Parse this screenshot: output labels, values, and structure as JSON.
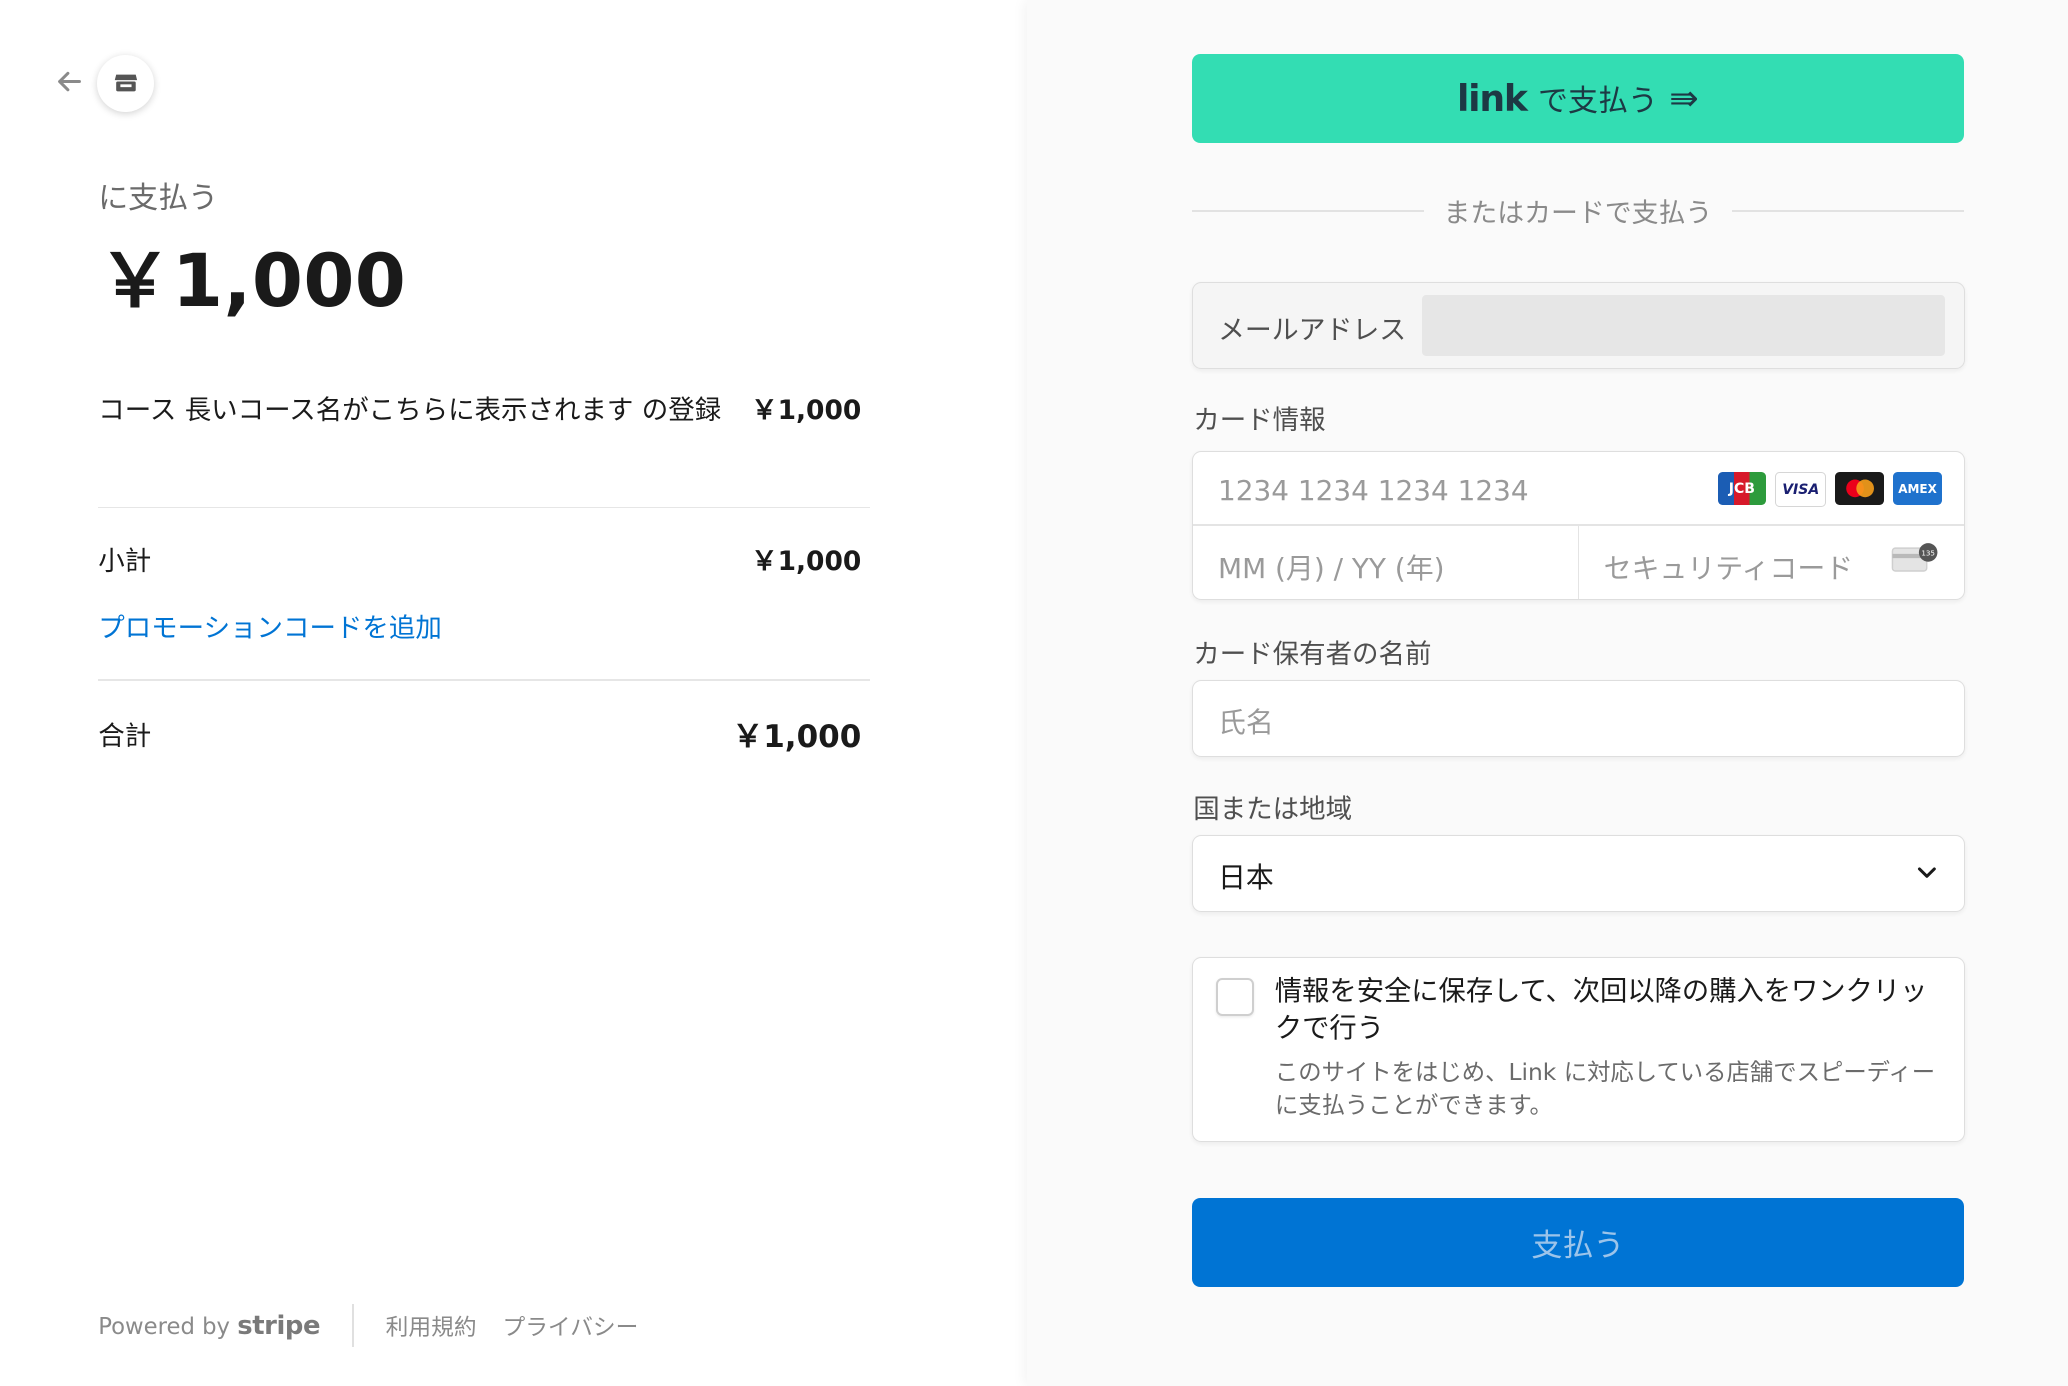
{
  "summary": {
    "pay_to": "に支払う",
    "amount": "￥1,000",
    "item_name": "コース 長いコース名がこちらに表示されます の登録",
    "item_price": "￥1,000",
    "subtotal_label": "小計",
    "subtotal_value": "￥1,000",
    "promo_link": "プロモーションコードを追加",
    "total_label": "合計",
    "total_value": "￥1,000"
  },
  "footer": {
    "powered_by": "Powered by",
    "stripe": "stripe",
    "terms": "利用規約",
    "privacy": "プライバシー"
  },
  "link_button": {
    "logo": "link",
    "label": "で支払う",
    "arrow": "⇛"
  },
  "or_divider": "またはカードで支払う",
  "email": {
    "label": "メールアドレス",
    "value": ""
  },
  "card": {
    "label": "カード情報",
    "number_placeholder": "1234 1234 1234 1234",
    "expiry_placeholder": "MM (月) / YY (年)",
    "cvc_placeholder": "セキュリティコード",
    "brands": [
      "JCB",
      "VISA",
      "Mastercard",
      "AMEX"
    ],
    "cvc_hint": "135"
  },
  "cardholder": {
    "label": "カード保有者の名前",
    "placeholder": "氏名"
  },
  "country": {
    "label": "国または地域",
    "value": "日本"
  },
  "save_info": {
    "title": "情報を安全に保存して、次回以降の購入をワンクリックで行う",
    "description": "このサイトをはじめ、Link に対応している店舗でスピーディーに支払うことができます。",
    "checked": false
  },
  "pay_button": {
    "label": "支払う"
  },
  "colors": {
    "link_green": "#33ddb3",
    "primary_blue": "#0074d4",
    "promo_blue": "#0074d4"
  }
}
